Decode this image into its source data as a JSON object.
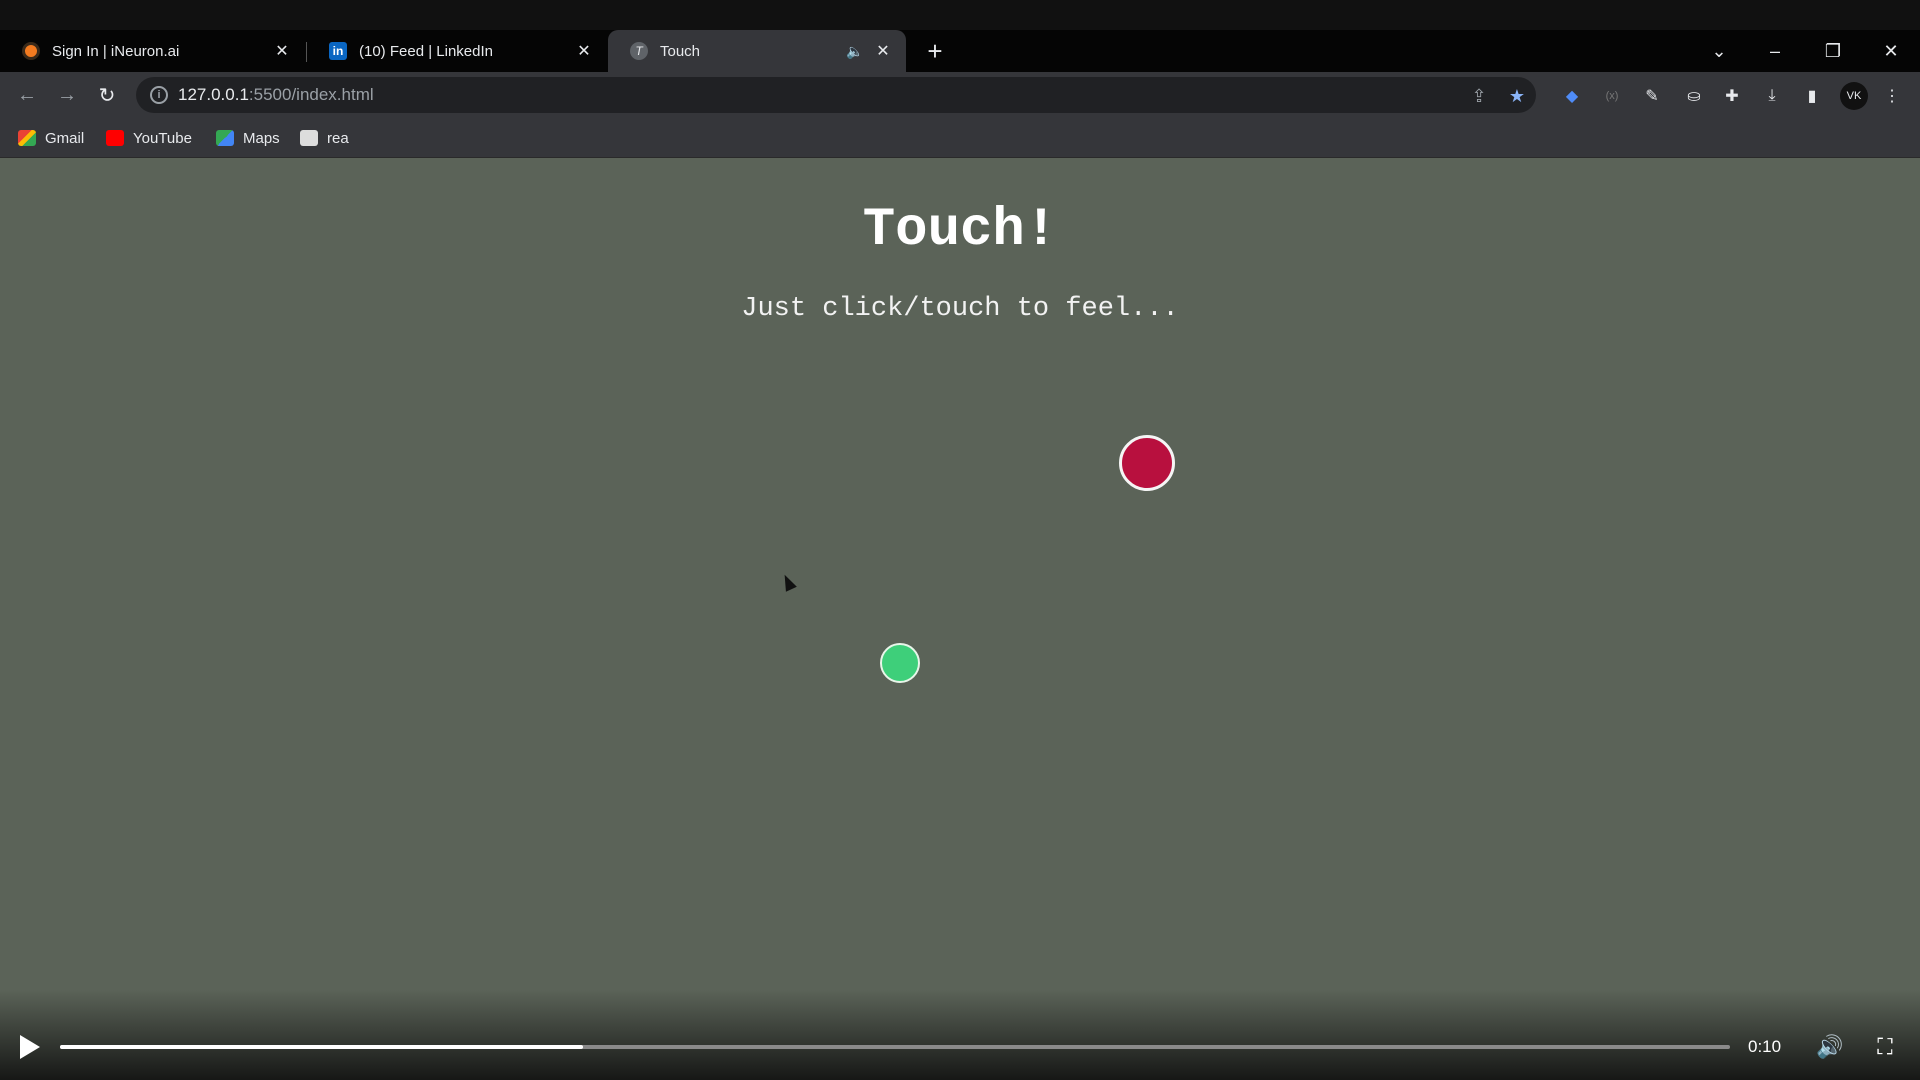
{
  "browser": {
    "tabs": [
      {
        "title": "Sign In | iNeuron.ai",
        "favicon": "ineuron-icon",
        "active": false
      },
      {
        "title": "(10) Feed | LinkedIn",
        "favicon": "linkedin-icon",
        "active": false
      },
      {
        "title": "Touch",
        "favicon": "t-icon",
        "active": true,
        "muted": true
      }
    ],
    "url": {
      "host": "127.0.0.1",
      "rest": ":5500/index.html"
    },
    "bookmarks": [
      {
        "label": "Gmail",
        "icon": "gmail-icon"
      },
      {
        "label": "YouTube",
        "icon": "youtube-icon"
      },
      {
        "label": "Maps",
        "icon": "maps-icon"
      },
      {
        "label": "rea",
        "icon": "rea-icon"
      }
    ]
  },
  "page": {
    "heading": "Touch!",
    "subtitle": "Just click/touch to feel...",
    "background_color": "#5b6358",
    "dots": [
      {
        "name": "red",
        "color": "#b8103e"
      },
      {
        "name": "green",
        "color": "#3ecf7a"
      }
    ]
  },
  "player": {
    "time": "0:10",
    "progress": 0.313
  }
}
